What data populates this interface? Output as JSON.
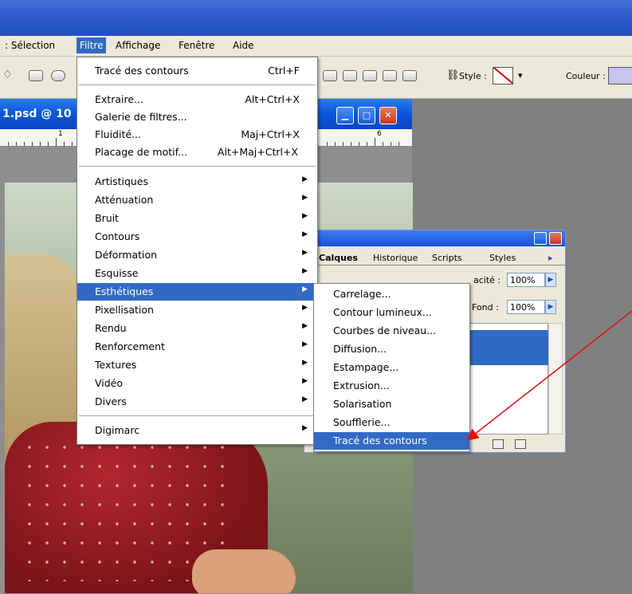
{
  "menubar": {
    "items": [
      {
        "label": "Sélection",
        "active": false
      },
      {
        "label": "Filtre",
        "active": true
      },
      {
        "label": "Affichage",
        "active": false
      },
      {
        "label": "Fenêtre",
        "active": false
      },
      {
        "label": "Aide",
        "active": false
      }
    ]
  },
  "toolbar": {
    "style_label": "Style :",
    "color_label": "Couleur :",
    "color_value": "#c8c4f0"
  },
  "document": {
    "title": "1.psd @ 10",
    "ruler_numbers": [
      "1",
      "6"
    ]
  },
  "filter_menu": {
    "groups": [
      [
        {
          "label": "Tracé des contours",
          "shortcut": "Ctrl+F"
        }
      ],
      [
        {
          "label": "Extraire...",
          "shortcut": "Alt+Ctrl+X"
        },
        {
          "label": "Galerie de filtres...",
          "shortcut": ""
        },
        {
          "label": "Fluidité...",
          "shortcut": "Maj+Ctrl+X"
        },
        {
          "label": "Placage de motif...",
          "shortcut": "Alt+Maj+Ctrl+X"
        }
      ],
      [
        {
          "label": "Artistiques",
          "submenu": true
        },
        {
          "label": "Atténuation",
          "submenu": true
        },
        {
          "label": "Bruit",
          "submenu": true
        },
        {
          "label": "Contours",
          "submenu": true
        },
        {
          "label": "Déformation",
          "submenu": true
        },
        {
          "label": "Esquisse",
          "submenu": true
        },
        {
          "label": "Esthétiques",
          "submenu": true,
          "highlighted": true
        },
        {
          "label": "Pixellisation",
          "submenu": true
        },
        {
          "label": "Rendu",
          "submenu": true
        },
        {
          "label": "Renforcement",
          "submenu": true
        },
        {
          "label": "Textures",
          "submenu": true
        },
        {
          "label": "Vidéo",
          "submenu": true
        },
        {
          "label": "Divers",
          "submenu": true
        }
      ],
      [
        {
          "label": "Digimarc",
          "submenu": true
        }
      ]
    ]
  },
  "esthetiques_submenu": {
    "items": [
      {
        "label": "Carrelage..."
      },
      {
        "label": "Contour lumineux..."
      },
      {
        "label": "Courbes de niveau..."
      },
      {
        "label": "Diffusion..."
      },
      {
        "label": "Estampage..."
      },
      {
        "label": "Extrusion..."
      },
      {
        "label": "Solarisation"
      },
      {
        "label": "Soufflerie..."
      },
      {
        "label": "Tracé des contours",
        "highlighted": true
      }
    ]
  },
  "layers_panel": {
    "tabs": [
      "Calques",
      "Historique",
      "Scripts",
      "Styles"
    ],
    "opacity_label": "acité :",
    "opacity_value": "100%",
    "fill_label": "Fond :",
    "fill_value": "100%"
  },
  "colors": {
    "selection": "#316ac5",
    "menu_bg": "#ece9d8",
    "arrow": "#e01010"
  }
}
